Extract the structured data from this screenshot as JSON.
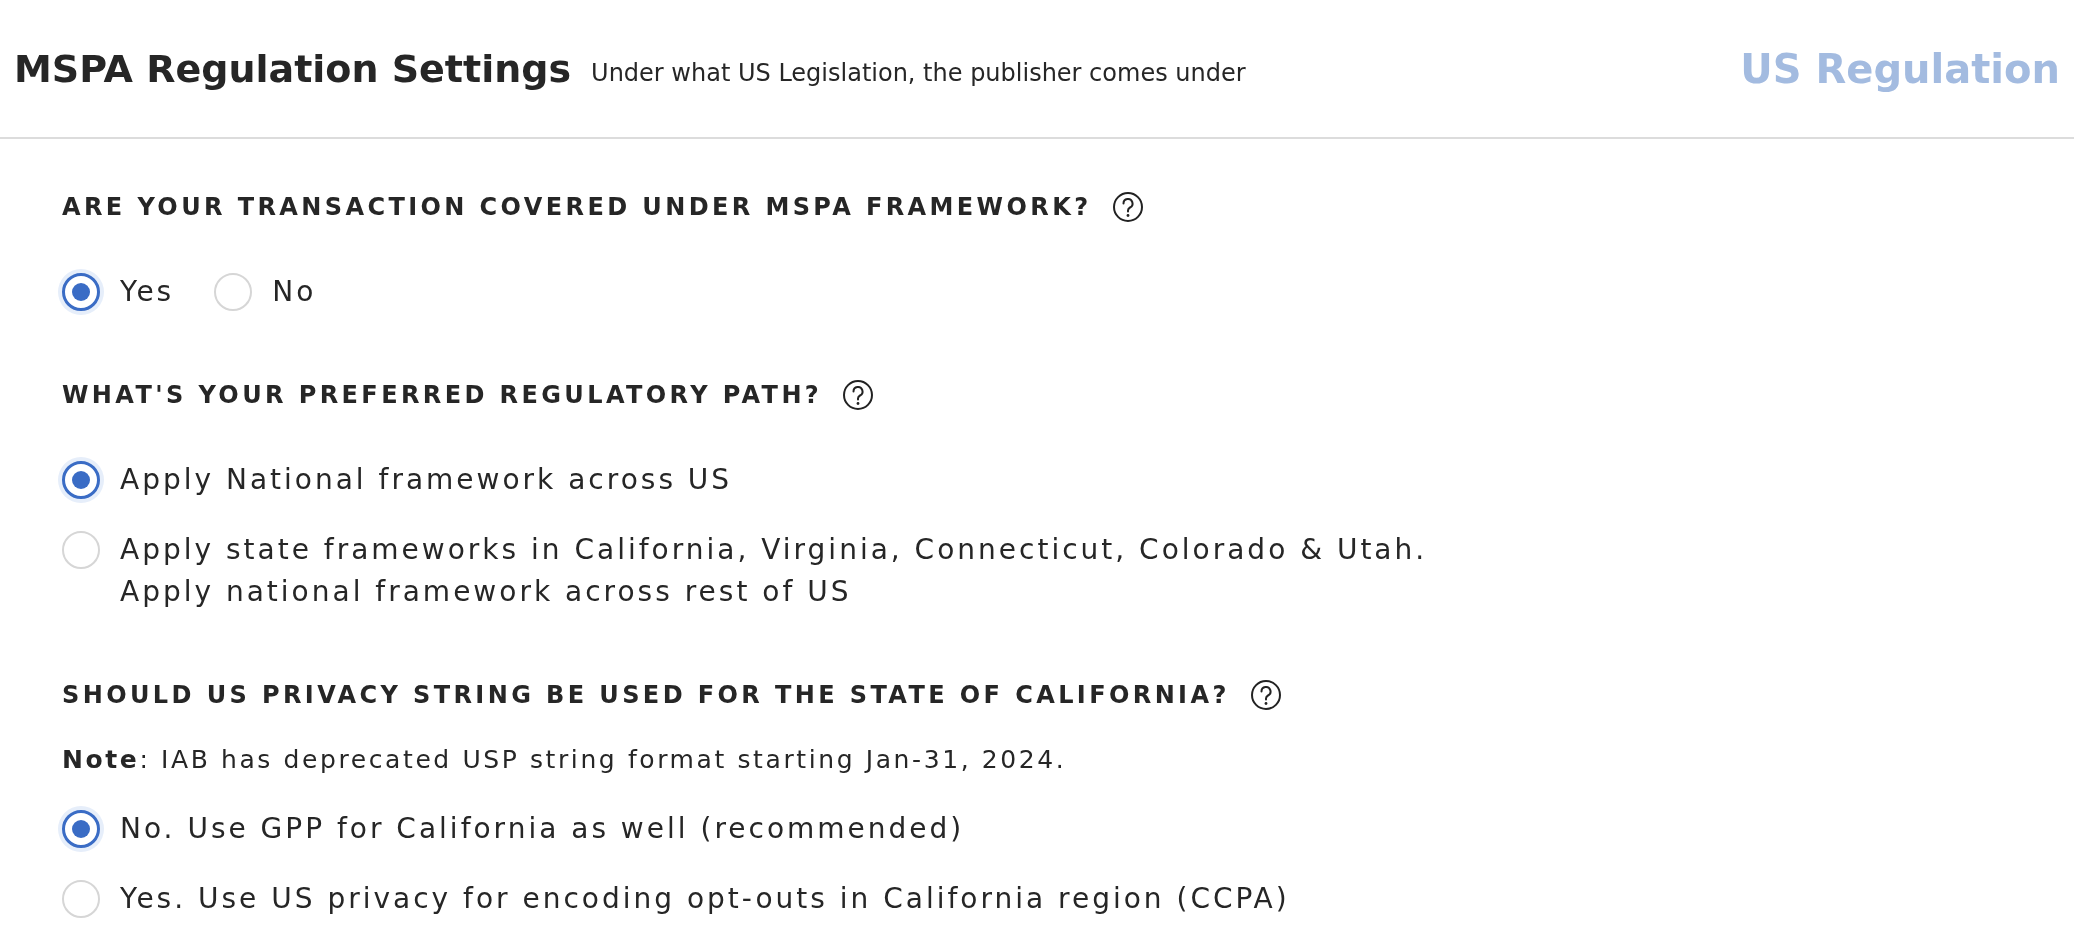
{
  "header": {
    "title": "MSPA Regulation Settings",
    "subtitle": "Under what US Legislation, the publisher comes under",
    "right_label": "US Regulation"
  },
  "questions": [
    {
      "heading": "ARE YOUR TRANSACTION COVERED UNDER MSPA FRAMEWORK?",
      "kind": "inline",
      "options": [
        {
          "label": "Yes",
          "selected": true
        },
        {
          "label": "No",
          "selected": false
        }
      ]
    },
    {
      "heading": "WHAT'S YOUR PREFERRED REGULATORY PATH?",
      "kind": "stacked",
      "options": [
        {
          "label": "Apply National framework across US",
          "selected": true
        },
        {
          "label": "Apply state frameworks in California, Virginia, Connecticut, Colorado & Utah.\nApply national framework across rest of US",
          "selected": false
        }
      ]
    },
    {
      "heading": "SHOULD US PRIVACY STRING BE USED FOR THE STATE OF CALIFORNIA?",
      "kind": "stacked",
      "note": "**Note**: IAB has deprecated USP string format starting Jan-31, 2024.",
      "options": [
        {
          "label": "No. Use GPP for California as well (recommended)",
          "selected": true
        },
        {
          "label": "Yes. Use US privacy for encoding opt-outs in California region (CCPA)",
          "selected": false
        }
      ]
    }
  ]
}
